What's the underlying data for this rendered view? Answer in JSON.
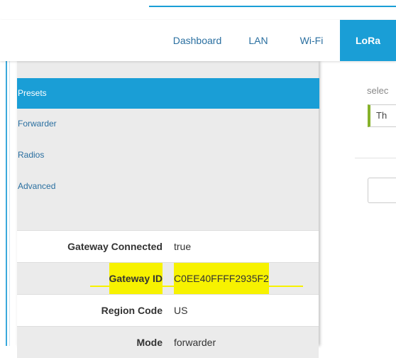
{
  "nav": {
    "items": [
      {
        "label": "Dashboard",
        "active": false
      },
      {
        "label": "LAN",
        "active": false
      },
      {
        "label": "Wi-Fi",
        "active": false
      },
      {
        "label": "LoRa",
        "active": true
      }
    ]
  },
  "sidebar": {
    "items": [
      {
        "label": "Presets",
        "active": true
      },
      {
        "label": "Forwarder",
        "active": false
      },
      {
        "label": "Radios",
        "active": false
      },
      {
        "label": "Advanced",
        "active": false
      }
    ]
  },
  "status": {
    "rows": [
      {
        "key": "Gateway Connected",
        "value": "true"
      },
      {
        "key": "Gateway ID",
        "value": "C0EE40FFFF2935F2",
        "highlighted": true
      },
      {
        "key": "Region Code",
        "value": "US"
      },
      {
        "key": "Mode",
        "value": "forwarder"
      }
    ]
  },
  "main": {
    "select_label": "selec",
    "select_value": "Th"
  },
  "colors": {
    "accent": "#1a9ed6",
    "highlight": "#f7f200",
    "select_border": "#86b22a"
  }
}
